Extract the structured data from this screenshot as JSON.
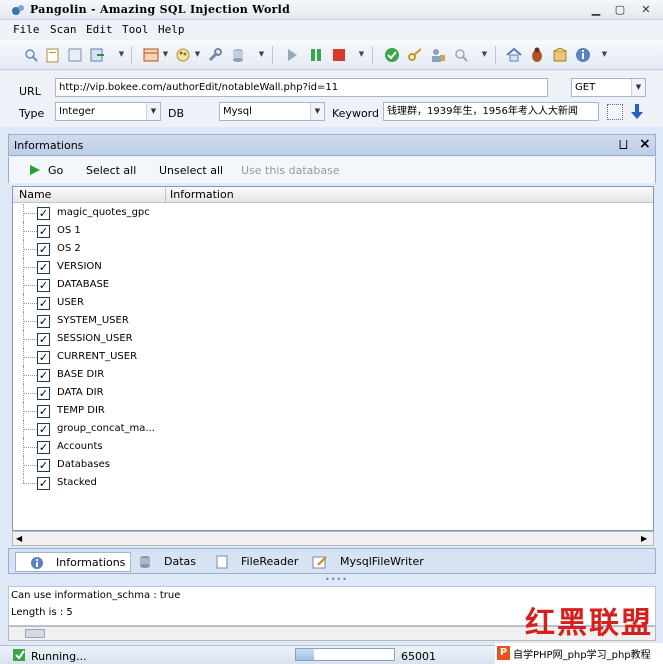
{
  "window": {
    "title": "Pangolin - Amazing SQL Injection World"
  },
  "menu": [
    "File",
    "Scan",
    "Edit",
    "Tool",
    "Help"
  ],
  "form": {
    "url_label": "URL",
    "url_value": "http://vip.bokee.com/authorEdit/notableWall.php?id=11",
    "method_value": "GET",
    "type_label": "Type",
    "type_value": "Integer",
    "db_label": "DB",
    "db_value": "Mysql",
    "keyword_label": "Keyword",
    "keyword_value": "钱理群，1939年生，1956年考入人大新闻"
  },
  "panel": {
    "title": "Informations",
    "pin_icon": "⨆",
    "close_icon": "×",
    "go_label": "Go",
    "select_all_label": "Select all",
    "unselect_all_label": "Unselect all",
    "use_db_label": "Use this database"
  },
  "grid": {
    "columns": [
      "Name",
      "Information"
    ],
    "rows": [
      "magic_quotes_gpc",
      "OS 1",
      "OS 2",
      "VERSION",
      "DATABASE",
      "USER",
      "SYSTEM_USER",
      "SESSION_USER",
      "CURRENT_USER",
      "BASE DIR",
      "DATA DIR",
      "TEMP DIR",
      "group_concat_ma...",
      "Accounts",
      "Databases",
      "Stacked"
    ],
    "checked": true
  },
  "tabs": [
    "Informations",
    "Datas",
    "FileReader",
    "MysqlFileWriter"
  ],
  "log": [
    "Can use information_schma : true",
    "Length is : 5"
  ],
  "status": {
    "running": "Running...",
    "progress_fraction": 0.18,
    "count": "65001"
  },
  "watermark": {
    "brand": "红黑联盟",
    "site": "自学PHP网_php学习_php教程"
  },
  "colors": {
    "accent": "#1f4e8f",
    "go": "#2aa12a",
    "stop": "#d83a2a"
  }
}
